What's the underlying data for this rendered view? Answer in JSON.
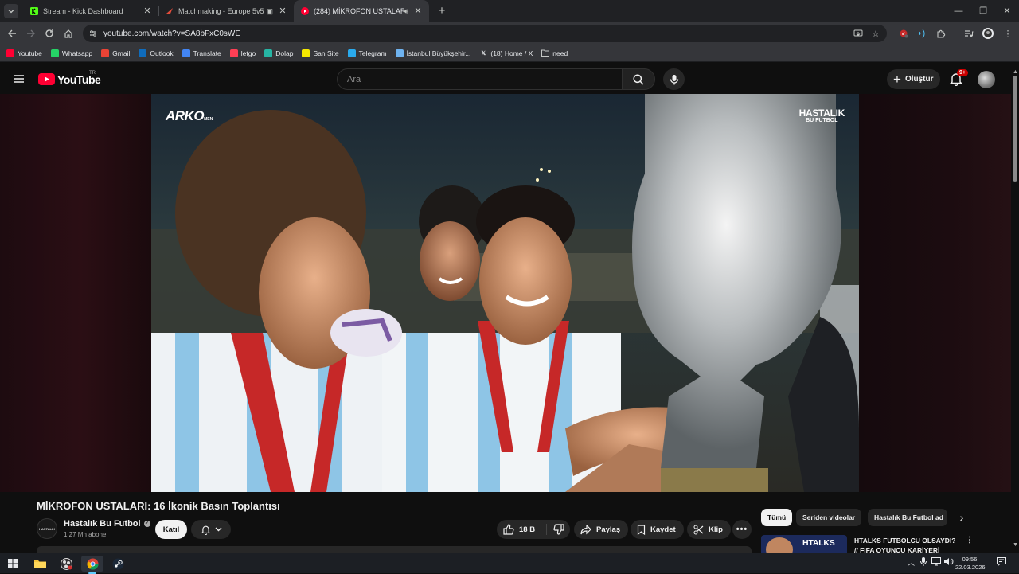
{
  "browser": {
    "tabs": [
      {
        "title": "Stream - Kick Dashboard",
        "active": false,
        "favicon_color": "#53fc18"
      },
      {
        "title": "Matchmaking - Europe 5v5",
        "active": false,
        "favicon_color": "#e24d3b"
      },
      {
        "title": "(284) MİKROFON USTALAR",
        "active": true,
        "favicon_color": "#ff0033"
      }
    ],
    "new_tab_label": "+",
    "url": "youtube.com/watch?v=SA8bFxC0sWE",
    "bookmarks": [
      {
        "label": "Youtube",
        "icon": "youtube-icon",
        "color": "#ff0033"
      },
      {
        "label": "Whatsapp",
        "icon": "whatsapp-icon",
        "color": "#25d366"
      },
      {
        "label": "Gmail",
        "icon": "gmail-icon",
        "color": "#ea4335"
      },
      {
        "label": "Outlook",
        "icon": "outlook-icon",
        "color": "#0f6cbd"
      },
      {
        "label": "Translate",
        "icon": "translate-icon",
        "color": "#4285f4"
      },
      {
        "label": "letgo",
        "icon": "letgo-icon",
        "color": "#ff3f55"
      },
      {
        "label": "Dolap",
        "icon": "dolap-icon",
        "color": "#26b5a4"
      },
      {
        "label": "San Site",
        "icon": "san-site-icon",
        "color": "#f5e800"
      },
      {
        "label": "Telegram",
        "icon": "telegram-icon",
        "color": "#2aabee"
      },
      {
        "label": "İstanbul Büyükşehir...",
        "icon": "istanbul-icon",
        "color": "#6fb3f0"
      },
      {
        "label": "(18) Home / X",
        "icon": "x-icon",
        "color": "#e8eaed"
      },
      {
        "label": "need",
        "icon": "folder-icon",
        "color": "#c4c7c5"
      }
    ]
  },
  "youtube": {
    "logo_text": "YouTube",
    "country_code": "TR",
    "search_placeholder": "Ara",
    "create_label": "Oluştur",
    "notifications_badge": "9+",
    "video": {
      "watermark_left": "ARKO",
      "watermark_left_small": "MEN",
      "watermark_right_line1": "HASTALIK",
      "watermark_right_line2": "BU FUTBOL"
    },
    "title": "MİKROFON USTALARI: 16 İkonik Basın Toplantısı",
    "channel": {
      "name": "Hastalık Bu Futbol",
      "avatar_text": "HASTALIK",
      "subscribers": "1,27 Mn abone"
    },
    "join_label": "Katıl",
    "likes": "18 B",
    "actions": {
      "share": "Paylaş",
      "save": "Kaydet",
      "clip": "Klip"
    },
    "chips": [
      "Tümü",
      "Seriden videolar",
      "Hastalık Bu Futbol ad"
    ],
    "recommended": {
      "thumb_text": "HTALKS",
      "title_line1": "HTALKS FUTBOLCU OLSAYDI?",
      "title_line2": "// FIFA OYUNCU KARİYERİ"
    }
  },
  "taskbar": {
    "time": "09:56",
    "date": "22.03.2026"
  }
}
